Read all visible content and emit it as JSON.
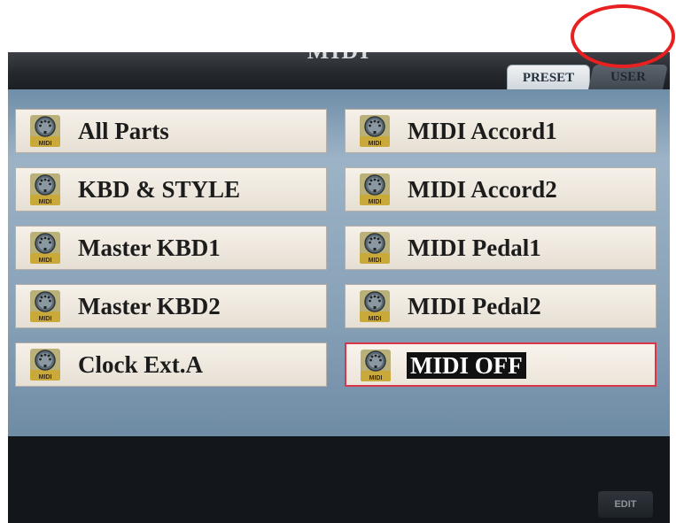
{
  "title": "MIDI",
  "tabs": [
    {
      "label": "PRESET",
      "active": true
    },
    {
      "label": "USER",
      "active": false
    }
  ],
  "icon": {
    "name": "midi-icon",
    "label": "MIDI"
  },
  "items": [
    {
      "label": "All Parts"
    },
    {
      "label": "MIDI Accord1"
    },
    {
      "label": "KBD & STYLE"
    },
    {
      "label": "MIDI Accord2"
    },
    {
      "label": "Master KBD1"
    },
    {
      "label": "MIDI Pedal1"
    },
    {
      "label": "Master KBD2"
    },
    {
      "label": "MIDI Pedal2"
    },
    {
      "label": "Clock Ext.A"
    },
    {
      "label": "MIDI OFF",
      "selected": true
    }
  ],
  "edit_button": {
    "label": "EDIT"
  },
  "colors": {
    "panel": "#8aa3b9",
    "item_bg": "#efe9df",
    "selection": "#d9364a",
    "annotation": "#e8201f"
  }
}
